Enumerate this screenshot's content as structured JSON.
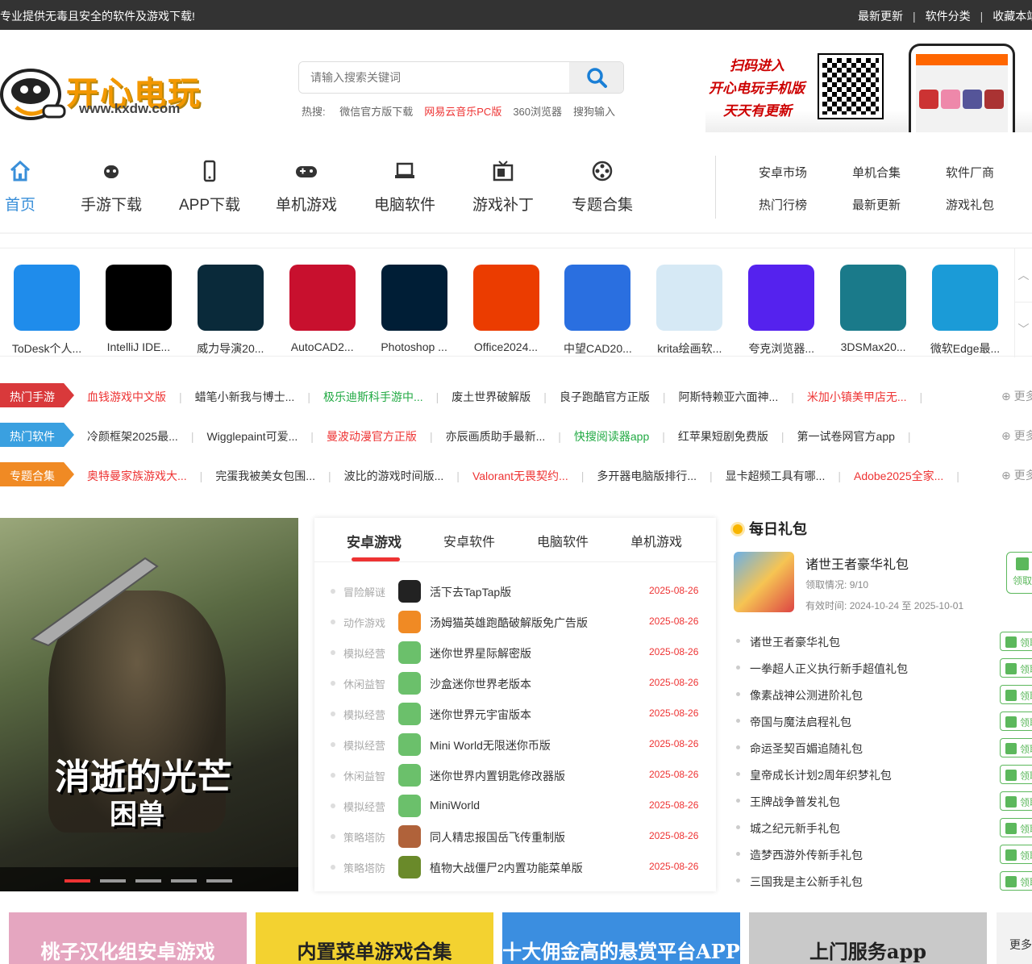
{
  "topbar": {
    "slogan": "专业提供无毒且安全的软件及游戏下载!",
    "links": [
      "最新更新",
      "软件分类",
      "收藏本站"
    ],
    "separator": "|"
  },
  "logo": {
    "text": "开心电玩",
    "url": "www.kxdw.com"
  },
  "search": {
    "placeholder": "请输入搜索关键词",
    "hot_label": "热搜:",
    "hot_items": [
      {
        "label": "微信官方版下载",
        "color": "#666666"
      },
      {
        "label": "网易云音乐PC版",
        "color": "#ee3333"
      },
      {
        "label": "360浏览器",
        "color": "#666666"
      },
      {
        "label": "搜狗输入",
        "color": "#666666"
      }
    ]
  },
  "qr_promo": {
    "line1": "扫码进入",
    "line2": "开心电玩手机版",
    "line3": "天天有更新"
  },
  "nav": {
    "main": [
      {
        "label": "首页",
        "icon": "home-icon",
        "active": true
      },
      {
        "label": "手游下载",
        "icon": "robot-icon"
      },
      {
        "label": "APP下载",
        "icon": "phone-icon"
      },
      {
        "label": "单机游戏",
        "icon": "gamepad-icon"
      },
      {
        "label": "电脑软件",
        "icon": "laptop-icon"
      },
      {
        "label": "游戏补丁",
        "icon": "tv-icon"
      },
      {
        "label": "专题合集",
        "icon": "film-reel-icon"
      }
    ],
    "sub": [
      "安卓市场",
      "单机合集",
      "软件厂商",
      "热门行榜",
      "最新更新",
      "游戏礼包"
    ]
  },
  "apps": [
    {
      "name": "ToDesk个人...",
      "color": "#1f8ceb"
    },
    {
      "name": "IntelliJ IDE...",
      "color": "#000000"
    },
    {
      "name": "威力导演20...",
      "color": "#0a2a3a"
    },
    {
      "name": "AutoCAD2...",
      "color": "#c8102e"
    },
    {
      "name": "Photoshop ...",
      "color": "#001e36"
    },
    {
      "name": "Office2024...",
      "color": "#eb3c00"
    },
    {
      "name": "中望CAD20...",
      "color": "#2a6fe0"
    },
    {
      "name": "krita绘画软...",
      "color": "#d6e9f5"
    },
    {
      "name": "夸克浏览器...",
      "color": "#5522ee"
    },
    {
      "name": "3DSMax20...",
      "color": "#1a7a8a"
    },
    {
      "name": "微软Edge最...",
      "color": "#1b9bd7"
    }
  ],
  "tag_rows": [
    {
      "tag": "热门手游",
      "color": "#d9393b",
      "links": [
        {
          "label": "血钱游戏中文版",
          "color": "#ee3333"
        },
        {
          "label": "蜡笔小新我与博士...",
          "color": "#333333"
        },
        {
          "label": "极乐迪斯科手游中...",
          "color": "#22aa44"
        },
        {
          "label": "废土世界破解版",
          "color": "#333333"
        },
        {
          "label": "良子跑酷官方正版",
          "color": "#333333"
        },
        {
          "label": "阿斯特赖亚六面神...",
          "color": "#333333"
        },
        {
          "label": "米加小镇美甲店无...",
          "color": "#ee3333"
        }
      ]
    },
    {
      "tag": "热门软件",
      "color": "#3aa0e0",
      "links": [
        {
          "label": "冷颜框架2025最...",
          "color": "#333333"
        },
        {
          "label": "Wigglepaint可爱...",
          "color": "#333333"
        },
        {
          "label": "曼波动漫官方正版",
          "color": "#ee3333"
        },
        {
          "label": "亦辰画质助手最新...",
          "color": "#333333"
        },
        {
          "label": "快搜阅读器app",
          "color": "#22aa44"
        },
        {
          "label": "红苹果短剧免费版",
          "color": "#333333"
        },
        {
          "label": "第一试卷网官方app",
          "color": "#333333"
        }
      ]
    },
    {
      "tag": "专题合集",
      "color": "#f08a24",
      "links": [
        {
          "label": "奥特曼家族游戏大...",
          "color": "#ee3333"
        },
        {
          "label": "完蛋我被美女包围...",
          "color": "#333333"
        },
        {
          "label": "波比的游戏时间版...",
          "color": "#333333"
        },
        {
          "label": "Valorant无畏契约...",
          "color": "#ee3333"
        },
        {
          "label": "多开器电脑版排行...",
          "color": "#333333"
        },
        {
          "label": "显卡超频工具有哪...",
          "color": "#333333"
        },
        {
          "label": "Adobe2025全家...",
          "color": "#ee3333"
        }
      ]
    }
  ],
  "more_label": "更多",
  "banner": {
    "title": "消逝的光芒",
    "subtitle": "困兽",
    "slides": 5,
    "active_slide": 1
  },
  "list_tabs": [
    "安卓游戏",
    "安卓软件",
    "电脑软件",
    "单机游戏"
  ],
  "list_rows": [
    {
      "cat": "冒险解谜",
      "name": "活下去TapTap版",
      "date": "2025-08-26",
      "color": "#222222"
    },
    {
      "cat": "动作游戏",
      "name": "汤姆猫英雄跑酷破解版免广告版",
      "date": "2025-08-26",
      "color": "#f08a24"
    },
    {
      "cat": "模拟经营",
      "name": "迷你世界星际解密版",
      "date": "2025-08-26",
      "color": "#6bc06b"
    },
    {
      "cat": "休闲益智",
      "name": "沙盒迷你世界老版本",
      "date": "2025-08-26",
      "color": "#6bc06b"
    },
    {
      "cat": "模拟经营",
      "name": "迷你世界元宇宙版本",
      "date": "2025-08-26",
      "color": "#6bc06b"
    },
    {
      "cat": "模拟经营",
      "name": "Mini World无限迷你币版",
      "date": "2025-08-26",
      "color": "#6bc06b"
    },
    {
      "cat": "休闲益智",
      "name": "迷你世界内置钥匙修改器版",
      "date": "2025-08-26",
      "color": "#6bc06b"
    },
    {
      "cat": "模拟经营",
      "name": "MiniWorld",
      "date": "2025-08-26",
      "color": "#6bc06b"
    },
    {
      "cat": "策略塔防",
      "name": "同人精忠报国岳飞传重制版",
      "date": "2025-08-26",
      "color": "#b0623a"
    },
    {
      "cat": "策略塔防",
      "name": "植物大战僵尸2内置功能菜单版",
      "date": "2025-08-26",
      "color": "#6a8a2a"
    }
  ],
  "gifts": {
    "header": "每日礼包",
    "featured": {
      "title": "诸世王者豪华礼包",
      "claimed_label": "领取情况:",
      "claimed": "9/10",
      "valid_label": "有效时间:",
      "valid": "2024-10-24 至 2025-10-01",
      "button": "领取"
    },
    "button_label": "领取",
    "items": [
      "诸世王者豪华礼包",
      "一拳超人正义执行新手超值礼包",
      "像素战神公测进阶礼包",
      "帝国与魔法启程礼包",
      "命运圣契百媚追随礼包",
      "皇帝成长计划2周年织梦礼包",
      "王牌战争普发礼包",
      "城之纪元新手礼包",
      "造梦西游外传新手礼包",
      "三国我是主公新手礼包"
    ]
  },
  "promos": [
    {
      "title": "桃子汉化组安卓游戏",
      "color": "#e5a6c0"
    },
    {
      "title": "内置菜单游戏合集",
      "color": "#f3d230"
    },
    {
      "title": "十大佣金高的悬赏平台APP",
      "color": "#3b8ee0"
    },
    {
      "title": "上门服务app",
      "color": "#c9c9c9"
    }
  ],
  "promos_more": "更多"
}
